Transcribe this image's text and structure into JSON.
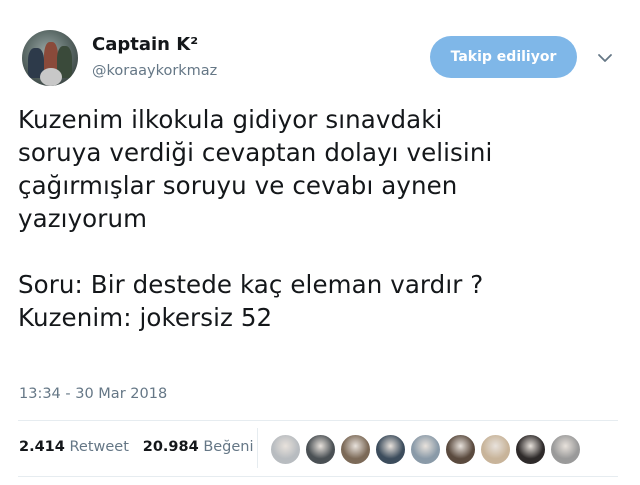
{
  "author": {
    "display_name": "Captain K²",
    "handle": "@koraaykorkmaz",
    "avatar": "avatar-image"
  },
  "follow_button": {
    "label": "Takip ediliyor"
  },
  "menu": {
    "icon": "chevron-down-icon"
  },
  "tweet": {
    "lines": [
      "Kuzenim ilkokula gidiyor sınavdaki",
      "soruya verdiği cevaptan dolayı velisini",
      "çağırmışlar soruyu ve cevabı aynen",
      "yazıyorum",
      "",
      "Soru: Bir destede kaç eleman vardır ?",
      "Kuzenim: jokersiz 52"
    ],
    "timestamp": "13:34 - 30 Mar 2018"
  },
  "stats": {
    "retweets_count": "2.414",
    "retweets_label": "Retweet",
    "likes_count": "20.984",
    "likes_label": "Beğeni"
  },
  "likers": [
    {
      "name": "liker-avatar-1",
      "color": "#b8bcc0"
    },
    {
      "name": "liker-avatar-2",
      "color": "#4a5054"
    },
    {
      "name": "liker-avatar-3",
      "color": "#7c6a58"
    },
    {
      "name": "liker-avatar-4",
      "color": "#3c4c5c"
    },
    {
      "name": "liker-avatar-5",
      "color": "#8a9aa8"
    },
    {
      "name": "liker-avatar-6",
      "color": "#5a4a3e"
    },
    {
      "name": "liker-avatar-7",
      "color": "#c8b49a"
    },
    {
      "name": "liker-avatar-8",
      "color": "#2e2a2a"
    },
    {
      "name": "liker-avatar-9",
      "color": "#9a9a9a"
    }
  ],
  "colors": {
    "follow_button_bg": "#7fb7e8",
    "secondary_text": "#657786",
    "primary_text": "#14171a"
  }
}
